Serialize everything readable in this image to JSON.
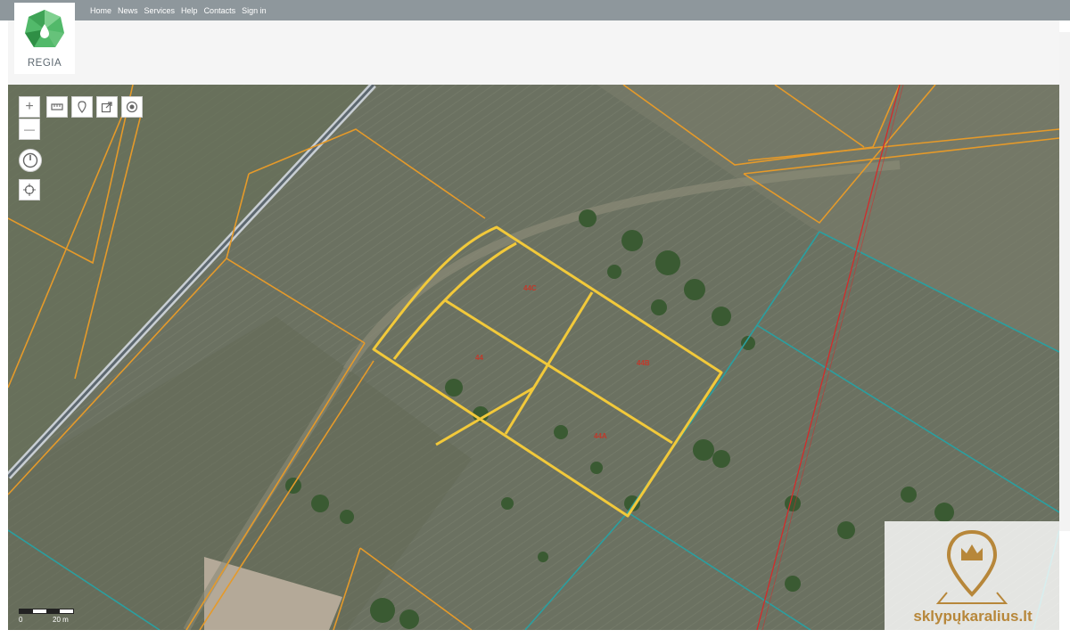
{
  "nav": {
    "items": [
      "Home",
      "News",
      "Services",
      "Help",
      "Contacts",
      "Sign in"
    ]
  },
  "logo": {
    "text": "REGIA"
  },
  "map": {
    "lots": [
      "44C",
      "44",
      "44B",
      "44A"
    ],
    "scale": {
      "start": "0",
      "end": "20 m"
    },
    "watermark": "sklypųkaralius.lt",
    "colors": {
      "selected_parcel": "#f2c93a",
      "parcel_boundary": "#e59a2a",
      "road_boundary": "#2a9fa0",
      "power_line": "#d42b2b"
    }
  },
  "controls": {
    "zoom_in": "+",
    "zoom_out": "—",
    "icons": [
      "ruler-icon",
      "marker-icon",
      "export-icon",
      "target-icon",
      "compass-icon",
      "locate-icon"
    ]
  }
}
